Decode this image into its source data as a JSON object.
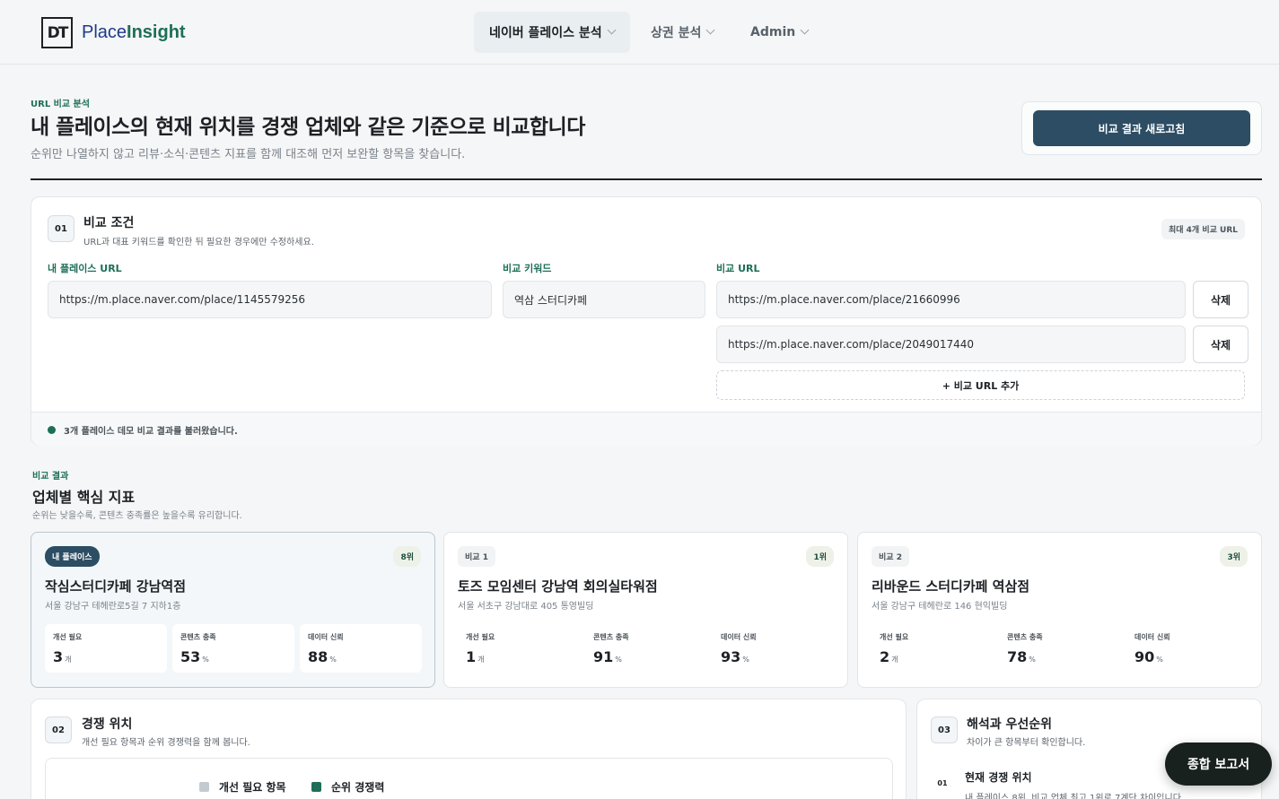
{
  "header": {
    "logo_mark": "DT",
    "brand_part1": "Place",
    "brand_part2": "Insight",
    "nav": [
      {
        "label": "네이버 플레이스 분석"
      },
      {
        "label": "상권 분석"
      },
      {
        "label": "Admin"
      }
    ]
  },
  "hero": {
    "eyebrow": "URL 비교 분석",
    "title": "내 플레이스의 현재 위치를 경쟁 업체와 같은 기준으로 비교합니다",
    "description": "순위만 나열하지 않고 리뷰·소식·콘텐츠 지표를 함께 대조해 먼저 보완할 항목을 찾습니다.",
    "refresh_label": "비교 결과 새로고침"
  },
  "conditions": {
    "num": "01",
    "title": "비교 조건",
    "subtitle": "URL과 대표 키워드를 확인한 뒤 필요한 경우에만 수정하세요.",
    "limit_badge": "최대 4개 비교 URL",
    "my_url_label": "내 플레이스 URL",
    "my_url_value": "https://m.place.naver.com/place/1145579256",
    "keyword_label": "비교 키워드",
    "keyword_value": "역삼 스터디카페",
    "compare_url_label": "비교 URL",
    "compare_urls": [
      {
        "value": "https://m.place.naver.com/place/21660996",
        "delete_label": "삭제"
      },
      {
        "value": "https://m.place.naver.com/place/2049017440",
        "delete_label": "삭제"
      }
    ],
    "add_url_label": "+ 비교 URL 추가",
    "status_text": "3개 플레이스 데모 비교 결과를 불러왔습니다."
  },
  "results": {
    "eyebrow": "비교 결과",
    "title": "업체별 핵심 지표",
    "description": "순위는 낮을수록, 콘텐츠 충족률은 높을수록 유리합니다.",
    "businesses": [
      {
        "tag": "내 플레이스",
        "rank": "8위",
        "name": "작심스터디카페 강남역점",
        "address": "서울 강남구 테헤란로5길 7 지하1층",
        "metrics": [
          {
            "label": "개선 필요",
            "value": "3",
            "unit": "개"
          },
          {
            "label": "콘텐츠 충족",
            "value": "53",
            "unit": "%"
          },
          {
            "label": "데이터 신뢰",
            "value": "88",
            "unit": "%"
          }
        ]
      },
      {
        "tag": "비교 1",
        "rank": "1위",
        "name": "토즈 모임센터 강남역 회의실타워점",
        "address": "서울 서초구 강남대로 405 통영빌딩",
        "metrics": [
          {
            "label": "개선 필요",
            "value": "1",
            "unit": "개"
          },
          {
            "label": "콘텐츠 충족",
            "value": "91",
            "unit": "%"
          },
          {
            "label": "데이터 신뢰",
            "value": "93",
            "unit": "%"
          }
        ]
      },
      {
        "tag": "비교 2",
        "rank": "3위",
        "name": "리바운드 스터디카페 역삼점",
        "address": "서울 강남구 테헤란로 146 현익빌딩",
        "metrics": [
          {
            "label": "개선 필요",
            "value": "2",
            "unit": "개"
          },
          {
            "label": "콘텐츠 충족",
            "value": "78",
            "unit": "%"
          },
          {
            "label": "데이터 신뢰",
            "value": "90",
            "unit": "%"
          }
        ]
      }
    ]
  },
  "position": {
    "num": "02",
    "title": "경쟁 위치",
    "subtitle": "개선 필요 항목과 순위 경쟁력을 함께 봅니다.",
    "legend": [
      {
        "label": "개선 필요 항목",
        "color": "#c3cbd1"
      },
      {
        "label": "순위 경쟁력",
        "color": "#1d6f57"
      }
    ]
  },
  "priority": {
    "num": "03",
    "title": "해석과 우선순위",
    "subtitle": "차이가 큰 항목부터 확인합니다.",
    "items": [
      {
        "num": "01",
        "title": "현재 경쟁 위치",
        "desc": "내 플레이스 8위, 비교 업체 최고 1위로 7계단 차이입니다."
      }
    ]
  },
  "fab_label": "종합 보고서"
}
